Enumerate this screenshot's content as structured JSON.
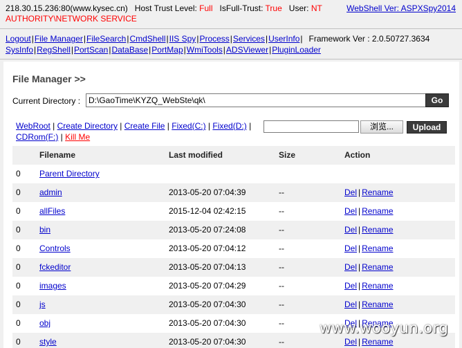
{
  "header": {
    "host": "218.30.15.236:80(www.kysec.cn)",
    "trust_label": "Host Trust Level:",
    "trust_value": "Full",
    "isfull_label": "IsFull-Trust:",
    "isfull_value": "True",
    "user_label": "User:",
    "user_value_1": "NT",
    "user_value_2": "AUTHORITY\\NETWORK SERVICE",
    "version_link": "WebShell Ver: ASPXSpy2014"
  },
  "nav": {
    "row1": [
      "Logout",
      "File Manager",
      "FileSearch",
      "CmdShell",
      "IIS Spy",
      "Process",
      "Services",
      "UserInfo"
    ],
    "framework": "Framework Ver : 2.0.50727.3634",
    "row2": [
      "SysInfo",
      "RegShell",
      "PortScan",
      "DataBase",
      "PortMap",
      "WmiTools",
      "ADSViewer",
      "PluginLoader"
    ]
  },
  "file_manager": {
    "title": "File Manager >>",
    "current_dir_label": "Current Directory :",
    "current_dir_value": "D:\\GaoTime\\KYZQ_WebSte\\qk\\",
    "go_label": "Go",
    "quick_links": [
      "WebRoot",
      "Create Directory",
      "Create File",
      "Fixed(C:)",
      "Fixed(D:)",
      "CDRom(F:)"
    ],
    "kill_me": "Kill Me",
    "browse_label": "浏览...",
    "upload_label": "Upload"
  },
  "table": {
    "headers": [
      "Filename",
      "Last modified",
      "Size",
      "Action"
    ],
    "parent": {
      "idx": "0",
      "name": "Parent Directory"
    },
    "rows": [
      {
        "idx": "0",
        "name": "admin",
        "modified": "2013-05-20 07:04:39",
        "size": "--",
        "del": "Del",
        "rename": "Rename"
      },
      {
        "idx": "0",
        "name": "allFiles",
        "modified": "2015-12-04 02:42:15",
        "size": "--",
        "del": "Del",
        "rename": "Rename"
      },
      {
        "idx": "0",
        "name": "bin",
        "modified": "2013-05-20 07:24:08",
        "size": "--",
        "del": "Del",
        "rename": "Rename"
      },
      {
        "idx": "0",
        "name": "Controls",
        "modified": "2013-05-20 07:04:12",
        "size": "--",
        "del": "Del",
        "rename": "Rename"
      },
      {
        "idx": "0",
        "name": "fckeditor",
        "modified": "2013-05-20 07:04:13",
        "size": "--",
        "del": "Del",
        "rename": "Rename"
      },
      {
        "idx": "0",
        "name": "images",
        "modified": "2013-05-20 07:04:29",
        "size": "--",
        "del": "Del",
        "rename": "Rename"
      },
      {
        "idx": "0",
        "name": "js",
        "modified": "2013-05-20 07:04:30",
        "size": "--",
        "del": "Del",
        "rename": "Rename"
      },
      {
        "idx": "0",
        "name": "obj",
        "modified": "2013-05-20 07:04:30",
        "size": "--",
        "del": "Del",
        "rename": "Rename"
      },
      {
        "idx": "0",
        "name": "style",
        "modified": "2013-05-20 07:04:30",
        "size": "--",
        "del": "Del",
        "rename": "Rename"
      }
    ]
  },
  "watermark": "www.wooyun.org"
}
